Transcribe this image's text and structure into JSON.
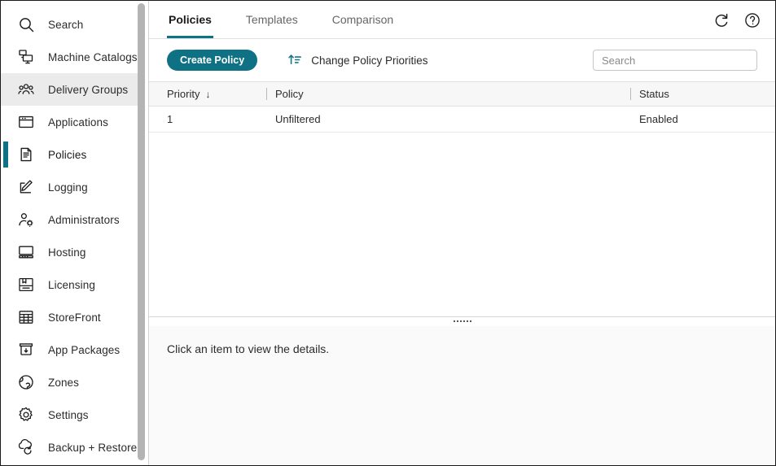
{
  "sidebar": {
    "items": [
      {
        "label": "Search",
        "icon": "search-icon",
        "state": "normal"
      },
      {
        "label": "Machine Catalogs",
        "icon": "machine-catalogs-icon",
        "state": "normal"
      },
      {
        "label": "Delivery Groups",
        "icon": "delivery-groups-icon",
        "state": "hovered"
      },
      {
        "label": "Applications",
        "icon": "applications-icon",
        "state": "normal"
      },
      {
        "label": "Policies",
        "icon": "policies-icon",
        "state": "active"
      },
      {
        "label": "Logging",
        "icon": "logging-icon",
        "state": "normal"
      },
      {
        "label": "Administrators",
        "icon": "administrators-icon",
        "state": "normal"
      },
      {
        "label": "Hosting",
        "icon": "hosting-icon",
        "state": "normal"
      },
      {
        "label": "Licensing",
        "icon": "licensing-icon",
        "state": "normal"
      },
      {
        "label": "StoreFront",
        "icon": "storefront-icon",
        "state": "normal"
      },
      {
        "label": "App Packages",
        "icon": "app-packages-icon",
        "state": "normal"
      },
      {
        "label": "Zones",
        "icon": "zones-icon",
        "state": "normal"
      },
      {
        "label": "Settings",
        "icon": "settings-icon",
        "state": "normal"
      },
      {
        "label": "Backup + Restore",
        "icon": "backup-restore-icon",
        "state": "normal"
      }
    ]
  },
  "tabs": [
    {
      "label": "Policies",
      "active": true
    },
    {
      "label": "Templates",
      "active": false
    },
    {
      "label": "Comparison",
      "active": false
    }
  ],
  "header_actions": [
    {
      "icon": "refresh-icon",
      "name": "refresh-button"
    },
    {
      "icon": "help-icon",
      "name": "help-button"
    }
  ],
  "toolbar": {
    "create_policy_label": "Create Policy",
    "change_priorities_label": "Change Policy Priorities",
    "change_priorities_icon": "sort-ascending-icon"
  },
  "search": {
    "placeholder": "Search",
    "value": ""
  },
  "table": {
    "columns": [
      {
        "label": "Priority",
        "sort": "↓"
      },
      {
        "label": "Policy",
        "sort": ""
      },
      {
        "label": "Status",
        "sort": ""
      }
    ],
    "rows": [
      {
        "priority": "1",
        "policy": "Unfiltered",
        "status": "Enabled"
      }
    ]
  },
  "detail": {
    "empty_text": "Click an item to view the details."
  },
  "colors": {
    "accent": "#0f7284",
    "button": "#0f7284",
    "icon_accent": "#17768a",
    "sidebar_hover": "#ebebeb",
    "panel_bg": "#fafafa"
  }
}
